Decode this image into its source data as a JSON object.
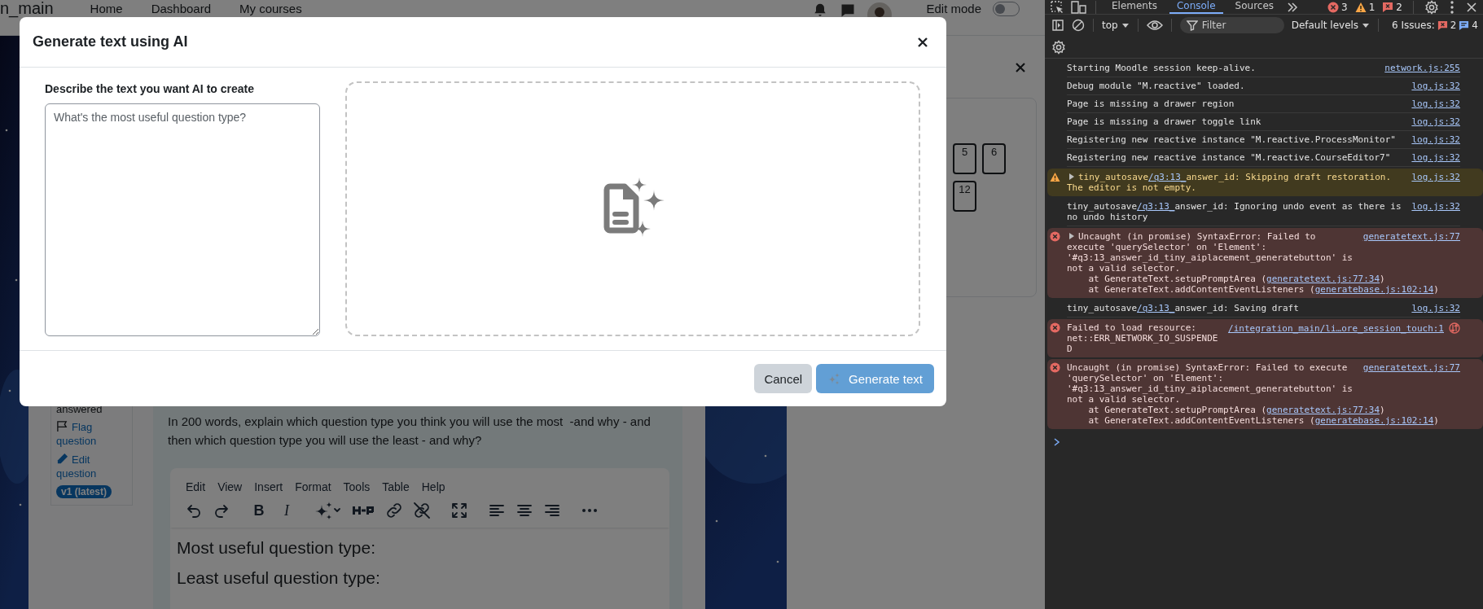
{
  "navbar": {
    "site_name": "n_main",
    "links": [
      "Home",
      "Dashboard",
      "My courses"
    ],
    "edit_mode": {
      "label": "Edit mode",
      "on": false
    }
  },
  "question": {
    "status": "answered",
    "actions": [
      {
        "kind": "flag",
        "label": "Flag question"
      },
      {
        "kind": "edit",
        "label": "Edit question"
      }
    ],
    "version": "v1 (latest)",
    "text": "In 200 words, explain which question type you think you will use the most  -and why - and then which question type you will use the least - and why?",
    "editor": {
      "menu": [
        "Edit",
        "View",
        "Insert",
        "Format",
        "Tools",
        "Table",
        "Help"
      ],
      "toolbar": [
        {
          "kind": "undo"
        },
        {
          "kind": "redo"
        },
        {
          "kind": "bold",
          "label": "B"
        },
        {
          "kind": "italic",
          "label": "I"
        },
        {
          "kind": "ai"
        },
        {
          "kind": "h5p"
        },
        {
          "kind": "link"
        },
        {
          "kind": "unlink"
        },
        {
          "kind": "fullscreen"
        },
        {
          "kind": "align-left"
        },
        {
          "kind": "align-center"
        },
        {
          "kind": "align-right"
        },
        {
          "kind": "more"
        }
      ],
      "content": [
        "Most useful question type:",
        "Least useful question type:"
      ]
    }
  },
  "quiz_navigation": {
    "buttons": [
      "5",
      "6",
      "12"
    ]
  },
  "modal": {
    "title": "Generate text using AI",
    "prompt_label": "Describe the text you want AI to create",
    "prompt_placeholder": "What's the most useful question type?",
    "buttons": [
      {
        "kind": "secondary",
        "label": "Cancel",
        "disabled": false
      },
      {
        "kind": "primary",
        "label": "Generate text",
        "disabled": true
      }
    ]
  },
  "devtools": {
    "tabs": [
      {
        "label": "Elements",
        "selected": false
      },
      {
        "label": "Console",
        "selected": true
      },
      {
        "label": "Sources",
        "selected": false
      }
    ],
    "counts": {
      "errors": "3",
      "warnings": "1",
      "issues": "2"
    },
    "context": "top",
    "filter_placeholder": "Filter",
    "levels": "Default levels",
    "issues": {
      "label": "6 Issues:",
      "errors": "2",
      "infos": "4"
    },
    "messages": [
      {
        "kind": "info",
        "parts": [
          {
            "text": "Starting Moodle session keep-alive."
          }
        ],
        "source": "network.js:255"
      },
      {
        "kind": "info",
        "parts": [
          {
            "text": "Debug module \"M.reactive\" loaded."
          }
        ],
        "source": "log.js:32"
      },
      {
        "kind": "info",
        "parts": [
          {
            "text": "Page is missing a drawer region"
          }
        ],
        "source": "log.js:32"
      },
      {
        "kind": "info",
        "parts": [
          {
            "text": "Page is missing a drawer toggle link"
          }
        ],
        "source": "log.js:32"
      },
      {
        "kind": "info",
        "parts": [
          {
            "text": "Registering new reactive instance \"M.reactive.ProcessMonitor\""
          }
        ],
        "source": "log.js:32"
      },
      {
        "kind": "info",
        "parts": [
          {
            "text": "Registering new reactive instance \"M.reactive.CourseEditor7\""
          }
        ],
        "source": "log.js:32"
      },
      {
        "kind": "warning",
        "expanded": false,
        "parts": [
          {
            "text": "tiny_autosave"
          },
          {
            "link": "/q3:13_"
          },
          {
            "text": "answer_id: Skipping draft restoration. The editor is not empty."
          }
        ],
        "source": "log.js:32"
      },
      {
        "kind": "info",
        "parts": [
          {
            "text": "tiny_autosave"
          },
          {
            "link": "/q3:13_"
          },
          {
            "text": "answer_id: Ignoring undo event as there is no undo history"
          }
        ],
        "source": "log.js:32"
      },
      {
        "kind": "error",
        "expanded": false,
        "parts": [
          {
            "text": "Uncaught (in promise) SyntaxError: Failed to execute 'querySelector' on 'Element': '#q3:13_answer_id_tiny_aiplacement_generatebutton' is not a valid selector."
          }
        ],
        "source": "generatetext.js:77",
        "stack": [
          [
            {
              "text": "at GenerateText.setupPromptArea ("
            },
            {
              "link": "generatetext.js:77:34"
            },
            {
              "text": ")"
            }
          ],
          [
            {
              "text": "at GenerateText.addContentEventListeners ("
            },
            {
              "link": "generatebase.js:102:14"
            },
            {
              "text": ")"
            }
          ]
        ]
      },
      {
        "kind": "info",
        "parts": [
          {
            "text": "tiny_autosave"
          },
          {
            "link": "/q3:13_"
          },
          {
            "text": "answer_id: Saving draft"
          }
        ],
        "source": "log.js:32"
      },
      {
        "kind": "error",
        "parts": [
          {
            "text": "Failed to load resource: net::ERR_NETWORK_IO_SUSPENDED"
          }
        ],
        "source": "/integration_main/li…ore_session_touch:1",
        "network_icon": true
      },
      {
        "kind": "error",
        "parts": [
          {
            "text": "Uncaught (in promise) SyntaxError: Failed to execute 'querySelector' on 'Element': '#q3:13_answer_id_tiny_aiplacement_generatebutton' is not a valid selector."
          }
        ],
        "source": "generatetext.js:77",
        "stack": [
          [
            {
              "text": "at GenerateText.setupPromptArea ("
            },
            {
              "link": "generatetext.js:77:34"
            },
            {
              "text": ")"
            }
          ],
          [
            {
              "text": "at GenerateText.addContentEventListeners ("
            },
            {
              "link": "generatebase.js:102:14"
            },
            {
              "text": ")"
            }
          ]
        ]
      }
    ]
  }
}
